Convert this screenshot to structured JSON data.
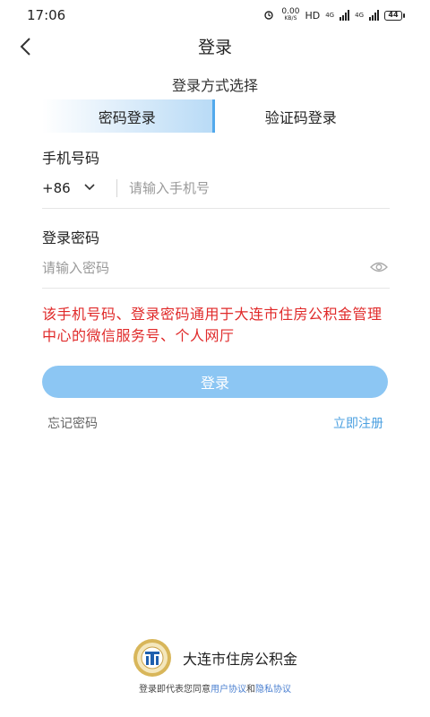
{
  "status": {
    "time": "17:06",
    "speed_value": "0.00",
    "speed_unit": "KB/S",
    "hd": "HD",
    "net1": "4G",
    "net2": "4G",
    "battery": "44"
  },
  "header": {
    "title": "登录",
    "back_icon": "chevron-left-icon"
  },
  "login_method": {
    "title": "登录方式选择",
    "tabs": [
      {
        "label": "密码登录",
        "active": true
      },
      {
        "label": "验证码登录",
        "active": false
      }
    ]
  },
  "form": {
    "phone_label": "手机号码",
    "country_code": "+86",
    "phone_placeholder": "请输入手机号",
    "password_label": "登录密码",
    "password_placeholder": "请输入密码",
    "password_toggle_icon": "eye-icon"
  },
  "notice": "该手机号码、登录密码通用于大连市住房公积金管理中心的微信服务号、个人网厅",
  "actions": {
    "login_label": "登录",
    "forgot_label": "忘记密码",
    "register_label": "立即注册"
  },
  "footer": {
    "brand_name": "大连市住房公积金",
    "agreement_prefix": "登录即代表您同意",
    "user_agreement": "用户协议",
    "and": "和",
    "privacy_policy": "隐私协议"
  },
  "colors": {
    "accent": "#4a9fe0",
    "button": "#8cc6f3",
    "warning": "#e02a2a"
  }
}
